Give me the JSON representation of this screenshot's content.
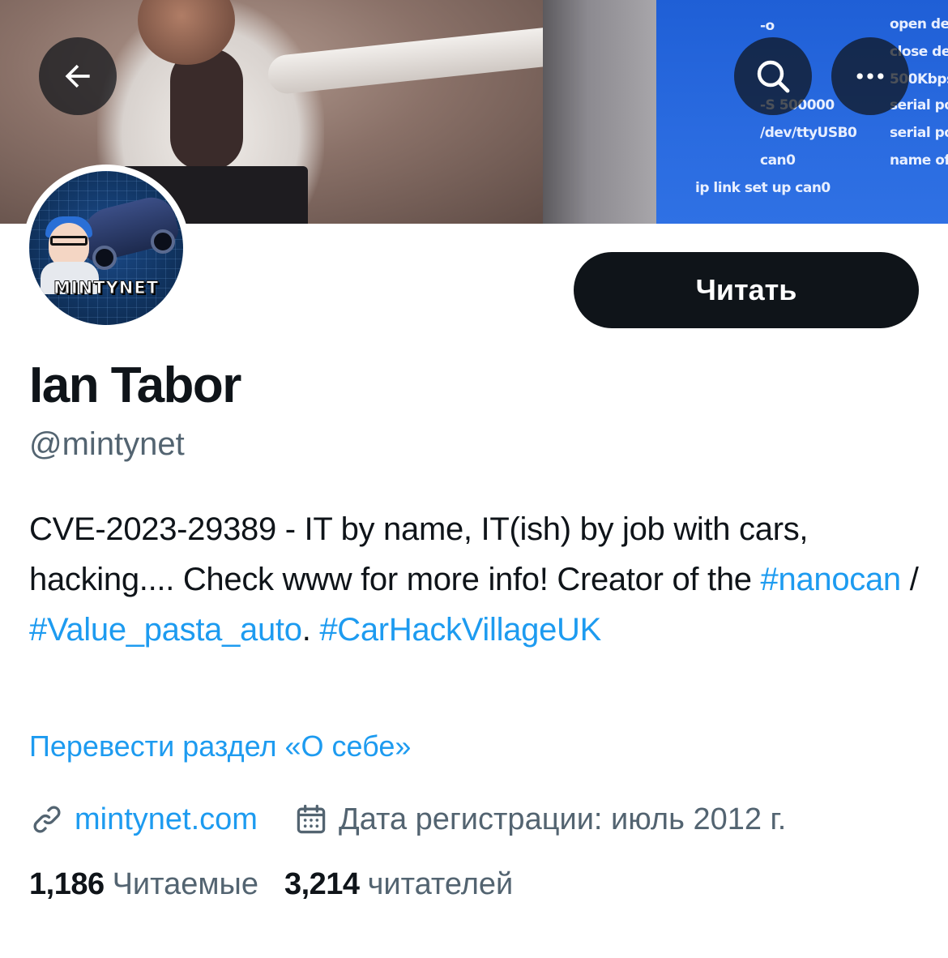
{
  "banner": {
    "screen_lines": [
      "-o",
      "-S 500000",
      "/dev/ttyUSB0",
      "can0",
      "ip link set up can0",
      "open de",
      "close de",
      "500Kbps",
      "serial po",
      "serial po",
      "name of"
    ],
    "colors": {
      "screen": "#2a6be0",
      "overlay_button": "#0f1419"
    }
  },
  "toolbar": {
    "back_icon": "arrow-left-icon",
    "search_icon": "search-icon",
    "more_icon": "more-horizontal-icon"
  },
  "profile": {
    "avatar_label": "MINTYNET",
    "follow_label": "Читать",
    "name": "Ian Tabor",
    "handle": "@mintynet",
    "bio": {
      "text1": "CVE-2023-29389 - IT by name, IT(ish) by job with cars, hacking.... Check www for more info! Creator of the ",
      "tag1": "#nanocan",
      "sep": " / ",
      "tag2": "#Value_pasta_auto",
      "text2": ". ",
      "tag3": "#CarHackVillageUK"
    },
    "translate_label": "Перевести раздел «О себе»",
    "website": "mintynet.com",
    "website_icon": "link-icon",
    "joined": "Дата регистрации: июль 2012 г.",
    "joined_icon": "calendar-icon",
    "following_count": "1,186",
    "following_label": "Читаемые",
    "followers_count": "3,214",
    "followers_label": "читателей"
  },
  "colors": {
    "accent": "#1d9bf0",
    "text_primary": "#0f1419",
    "text_secondary": "#536471"
  }
}
